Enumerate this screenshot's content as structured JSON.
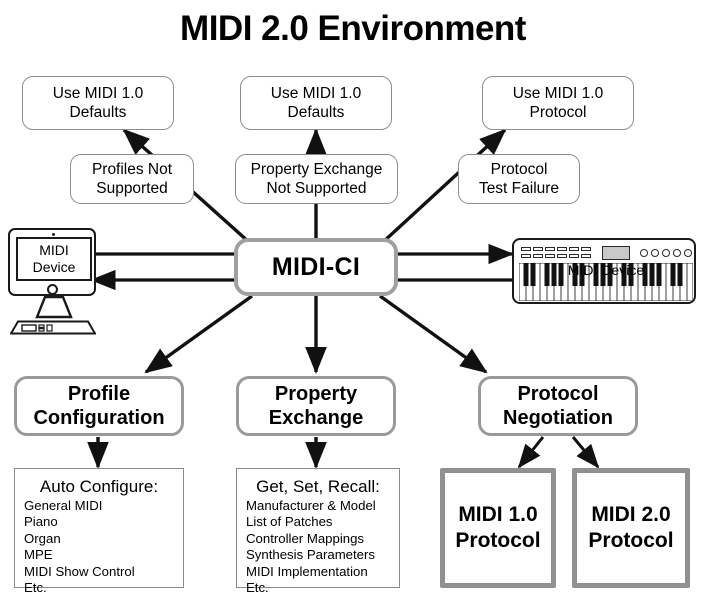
{
  "title": "MIDI 2.0 Environment",
  "center_node": {
    "label": "MIDI-CI"
  },
  "devices": {
    "computer": {
      "label_line1": "MIDI",
      "label_line2": "Device",
      "icon": "desktop-computer-icon"
    },
    "synth": {
      "label": "MIDI Device",
      "icon": "midi-keyboard-icon"
    }
  },
  "top_results": [
    {
      "line1": "Use MIDI 1.0",
      "line2": "Defaults"
    },
    {
      "line1": "Use MIDI 1.0",
      "line2": "Defaults"
    },
    {
      "line1": "Use MIDI 1.0",
      "line2": "Protocol"
    }
  ],
  "failure_conditions": [
    {
      "line1": "Profiles Not",
      "line2": "Supported"
    },
    {
      "line1": "Property Exchange",
      "line2": "Not Supported"
    },
    {
      "line1": "Protocol",
      "line2": "Test Failure"
    }
  ],
  "features": [
    {
      "line1": "Profile",
      "line2": "Configuration"
    },
    {
      "line1": "Property",
      "line2": "Exchange"
    },
    {
      "line1": "Protocol",
      "line2": "Negotiation"
    }
  ],
  "detail_lists": [
    {
      "heading": "Auto Configure:",
      "items": [
        "General MIDI",
        "Piano",
        "Organ",
        "MPE",
        "MIDI Show Control",
        "Etc."
      ]
    },
    {
      "heading": "Get, Set, Recall:",
      "items": [
        "Manufacturer & Model",
        "List of Patches",
        "Controller Mappings",
        "Synthesis Parameters",
        "MIDI Implementation",
        "Etc."
      ]
    }
  ],
  "protocols": [
    {
      "line1": "MIDI 1.0",
      "line2": "Protocol"
    },
    {
      "line1": "MIDI 2.0",
      "line2": "Protocol"
    }
  ],
  "colors": {
    "background": "#ffffff",
    "text": "#000000",
    "box_border": "#8c8c8c",
    "thick_border": "#9a9a9a",
    "protocol_border": "#909090",
    "arrow": "#111111",
    "display_fill": "#c9c9c9"
  }
}
